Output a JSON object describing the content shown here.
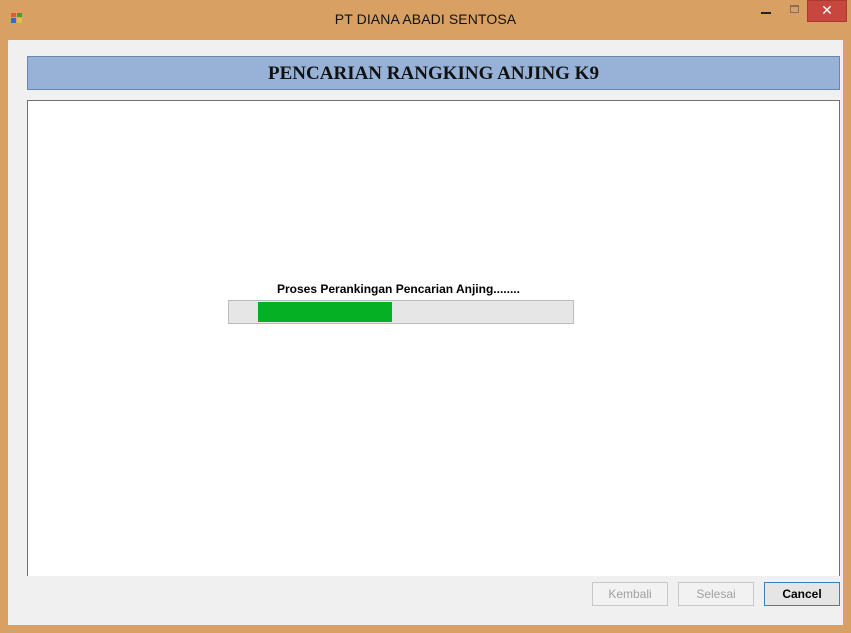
{
  "window": {
    "title": "PT DIANA ABADI SENTOSA",
    "controls": {
      "minimize": "−",
      "maximize": "☐",
      "close": "✕"
    }
  },
  "header": {
    "title": "PENCARIAN RANGKING ANJING K9"
  },
  "progress": {
    "label": "Proses Perankingan Pencarian Anjing........",
    "value_percent": 39,
    "offset_percent": 8.5,
    "color": "#06b025"
  },
  "buttons": {
    "back_label": "Kembali",
    "finish_label": "Selesai",
    "cancel_label": "Cancel"
  },
  "colors": {
    "titlebar": "#d8a062",
    "header_band": "#97b2d6",
    "close_button": "#c7463d"
  }
}
